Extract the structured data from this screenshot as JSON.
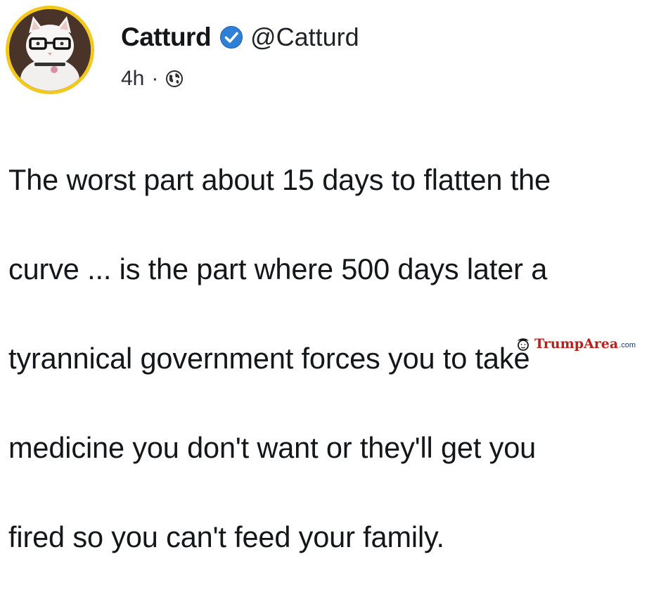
{
  "post": {
    "author": {
      "display_name": "Catturd",
      "handle": "@Catturd",
      "verified": true,
      "avatar_icon": "avatar"
    },
    "timestamp": "4h",
    "separator": "·",
    "visibility_icon": "globe-icon",
    "text_lines": [
      "The worst part about 15 days to flatten the",
      "curve ... is the part where 500 days later a",
      "tyrannical government forces you to take",
      "medicine you don't want or they'll get you",
      "fired so you can't feed your family."
    ]
  },
  "watermark": {
    "brand": "TrumpArea",
    "tld": ".com",
    "icon": "trump-logo-icon"
  },
  "colors": {
    "verified_blue": "#1d9bf0",
    "avatar_ring": "#f2c81c",
    "watermark_red": "#b8201a",
    "watermark_blue": "#1a3b7a"
  }
}
